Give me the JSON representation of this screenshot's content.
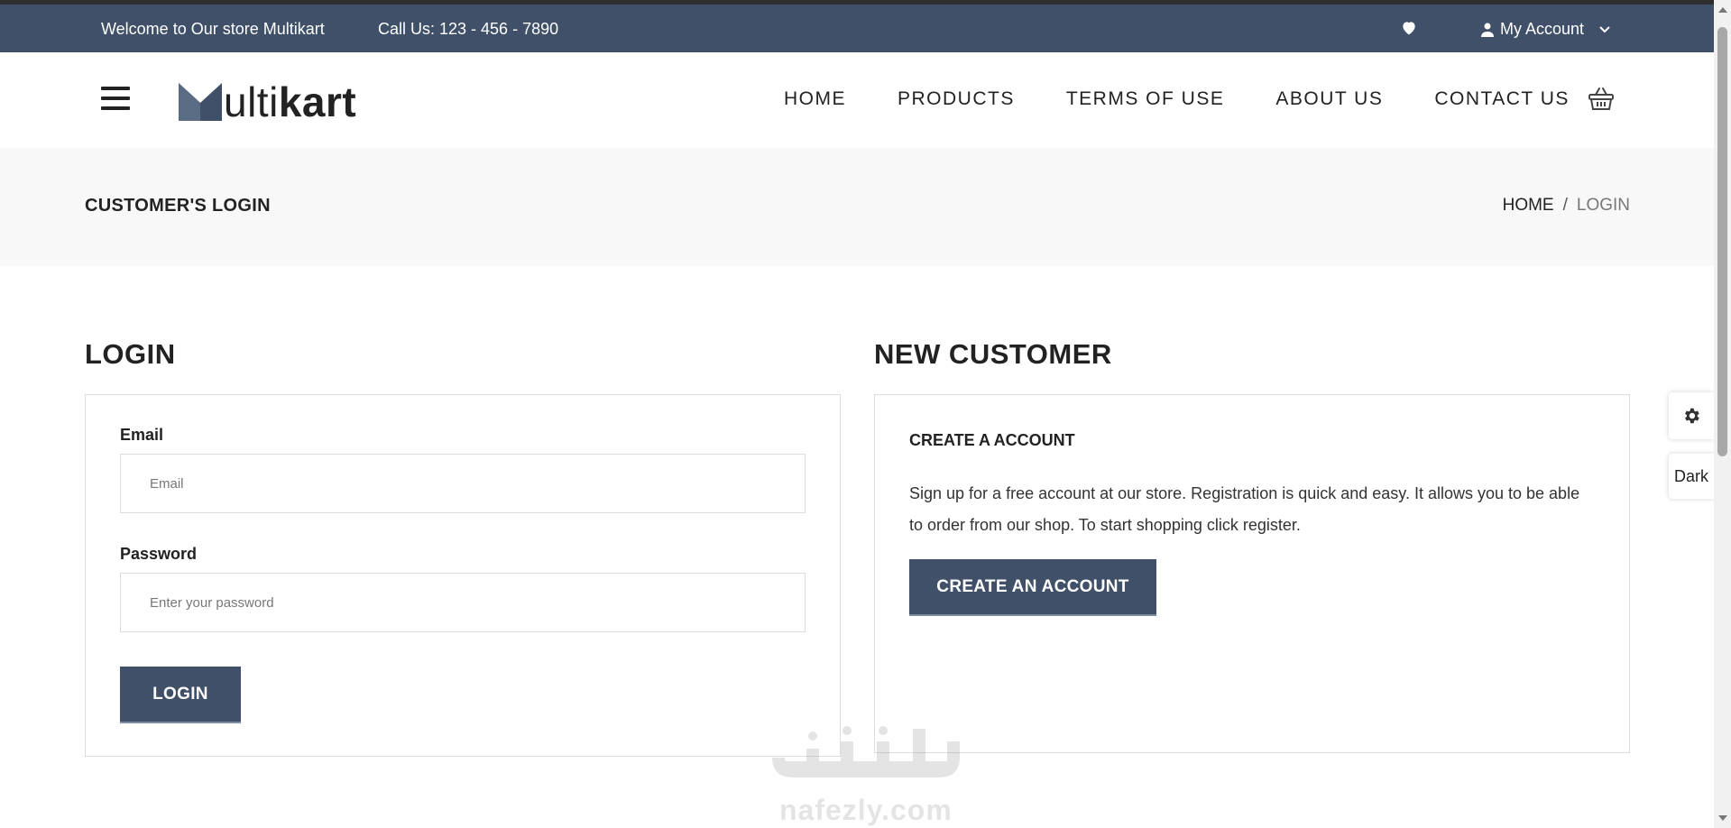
{
  "topbar": {
    "welcome": "Welcome to Our store Multikart",
    "call": "Call Us: 123 - 456 - 7890",
    "account_label": "My Account"
  },
  "header": {
    "logo": {
      "prefix": "ulti",
      "bold": "kart"
    },
    "nav": [
      {
        "label": "HOME"
      },
      {
        "label": "PRODUCTS"
      },
      {
        "label": "TERMS OF USE"
      },
      {
        "label": "ABOUT US"
      },
      {
        "label": "CONTACT US"
      }
    ]
  },
  "breadcrumb": {
    "page_title": "CUSTOMER'S LOGIN",
    "home": "HOME",
    "separator": "/",
    "current": "LOGIN"
  },
  "login": {
    "heading": "LOGIN",
    "email_label": "Email",
    "email_placeholder": "Email",
    "password_label": "Password",
    "password_placeholder": "Enter your password",
    "button": "LOGIN"
  },
  "new_customer": {
    "heading": "NEW CUSTOMER",
    "subheading": "CREATE A ACCOUNT",
    "text": "Sign up for a free account at our store. Registration is quick and easy. It allows you to be able to order from our shop. To start shopping click register.",
    "button": "CREATE AN ACCOUNT"
  },
  "side_panel": {
    "dark_label": "Dark"
  },
  "watermark": {
    "latin": "nafezly.com"
  },
  "colors": {
    "primary": "#3f5068",
    "breadcrumb_bg": "#f8f8f8",
    "border": "#dddddd"
  }
}
